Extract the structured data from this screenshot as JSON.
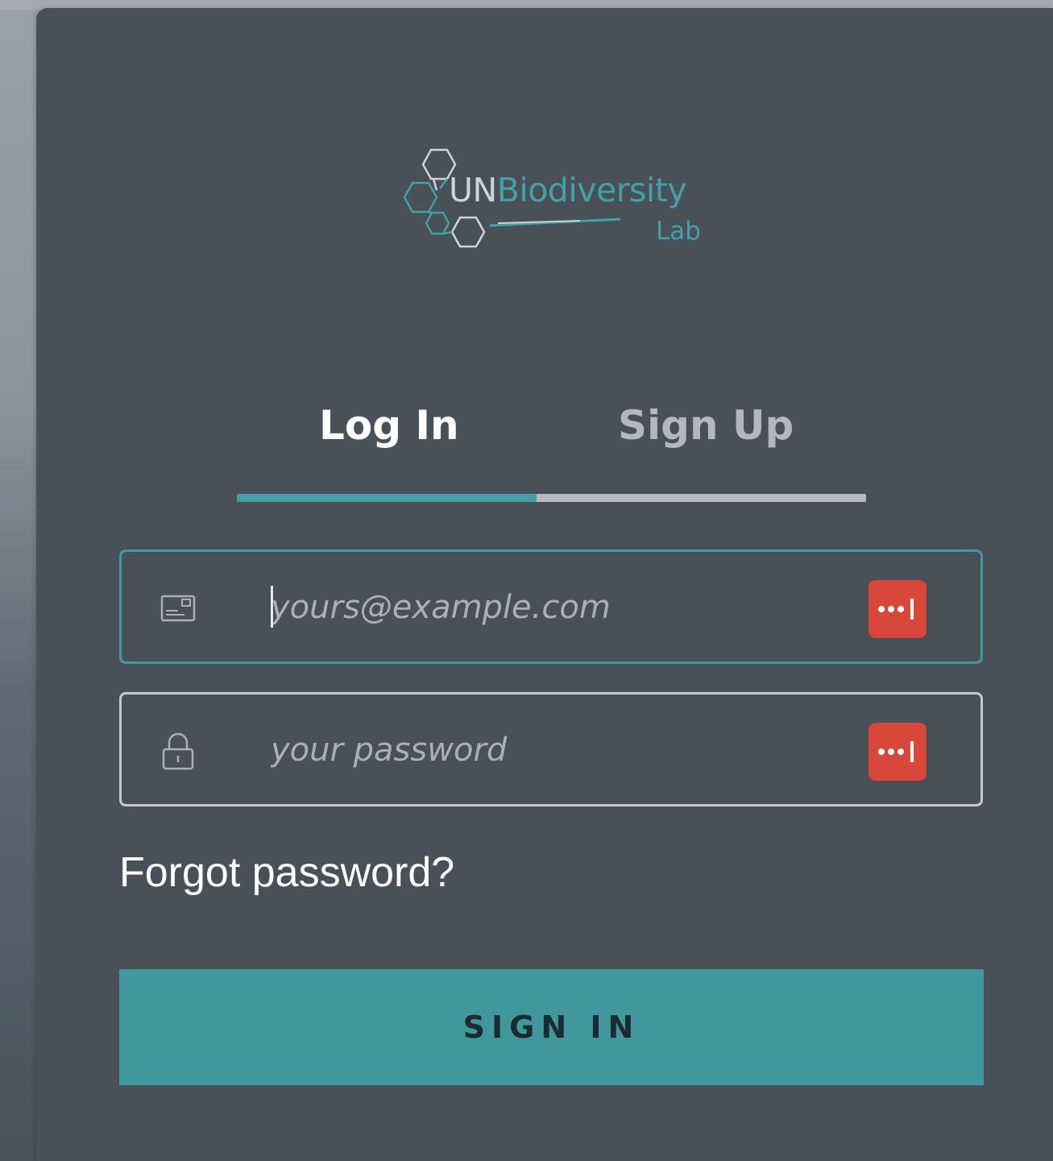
{
  "logo": {
    "title_prefix": "UN",
    "title_main": "Biodiversity",
    "subtitle": "Lab",
    "icon": "hexagon-cluster-icon",
    "colors": {
      "teal": "#45a0a6",
      "light": "#c9d6d8"
    }
  },
  "tabs": [
    {
      "label": "Log In",
      "active": true
    },
    {
      "label": "Sign Up",
      "active": false
    }
  ],
  "email_field": {
    "icon": "envelope-icon",
    "placeholder": "yours@example.com",
    "value": "",
    "focused": true,
    "autofill_icon": "password-manager-icon"
  },
  "password_field": {
    "icon": "lock-icon",
    "placeholder": "your password",
    "value": "",
    "autofill_icon": "password-manager-icon"
  },
  "forgot_link": "Forgot password?",
  "submit_label": "SIGN IN",
  "colors": {
    "card_bg": "#4a5058",
    "accent": "#45a0a6",
    "button": "#41979e",
    "autofill_badge": "#d9473a",
    "inactive_tab": "#b3b8bd"
  }
}
